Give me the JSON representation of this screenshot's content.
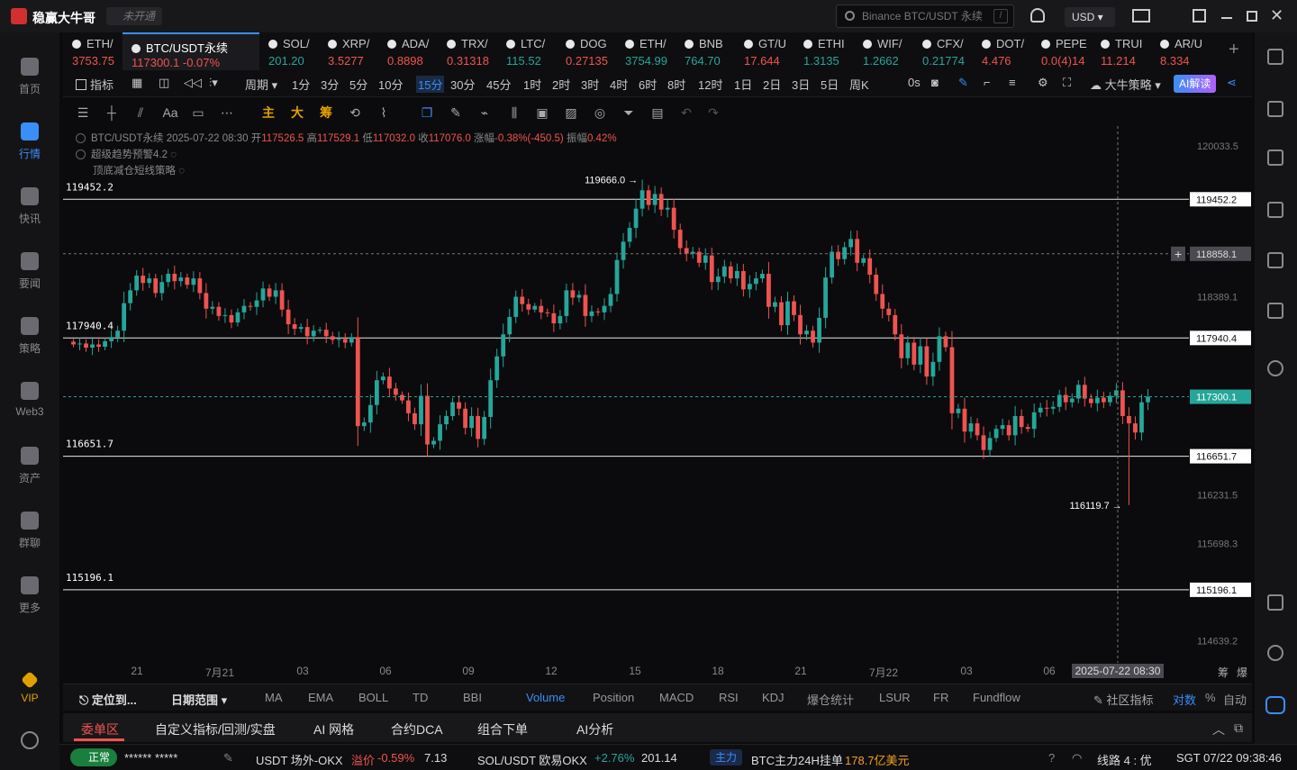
{
  "app": {
    "title": "稳赢大牛哥",
    "status_badge": "未开通"
  },
  "search": {
    "placeholder": "Binance BTC/USDT 永续",
    "shortcut": "/"
  },
  "currency": "USD",
  "sidebar": {
    "items": [
      {
        "label": "首页"
      },
      {
        "label": "行情"
      },
      {
        "label": "快讯"
      },
      {
        "label": "要闻"
      },
      {
        "label": "策略"
      },
      {
        "label": "Web3"
      },
      {
        "label": "资产"
      },
      {
        "label": "群聊"
      },
      {
        "label": "更多"
      },
      {
        "label": "VIP"
      }
    ],
    "active_index": 1
  },
  "tickers": [
    {
      "sym": "ETH/",
      "price": "3753.75",
      "dir": "down"
    },
    {
      "sym": "BTC/USDT永续",
      "price": "117300.1  -0.07%",
      "dir": "down"
    },
    {
      "sym": "SOL/",
      "price": "201.20",
      "dir": "up"
    },
    {
      "sym": "XRP/",
      "price": "3.5277",
      "dir": "down"
    },
    {
      "sym": "ADA/",
      "price": "0.8898",
      "dir": "down"
    },
    {
      "sym": "TRX/",
      "price": "0.31318",
      "dir": "down"
    },
    {
      "sym": "LTC/",
      "price": "115.52",
      "dir": "up"
    },
    {
      "sym": "DOG",
      "price": "0.27135",
      "dir": "down"
    },
    {
      "sym": "ETH/",
      "price": "3754.99",
      "dir": "up"
    },
    {
      "sym": "BNB",
      "price": "764.70",
      "dir": "up"
    },
    {
      "sym": "GT/U",
      "price": "17.644",
      "dir": "down"
    },
    {
      "sym": "ETHI",
      "price": "1.3135",
      "dir": "up"
    },
    {
      "sym": "WIF/",
      "price": "1.2662",
      "dir": "up"
    },
    {
      "sym": "CFX/",
      "price": "0.21774",
      "dir": "up"
    },
    {
      "sym": "DOT/",
      "price": "4.476",
      "dir": "down"
    },
    {
      "sym": "PEPE",
      "price": "0.0(4)14",
      "dir": "down"
    },
    {
      "sym": "TRUI",
      "price": "11.214",
      "dir": "down"
    },
    {
      "sym": "AR/U",
      "price": "8.334",
      "dir": "down"
    }
  ],
  "toolbar": {
    "indicator": "指标",
    "period": "周期",
    "periods": [
      "1分",
      "3分",
      "5分",
      "10分",
      "15分",
      "30分",
      "45分",
      "1时",
      "2时",
      "3时",
      "4时",
      "6时",
      "8时",
      "12时",
      "1日",
      "2日",
      "3日",
      "5日",
      "周K"
    ],
    "selected_period": "15分",
    "countdown": "0s",
    "strategy": "大牛策略",
    "ai_read": "AI解读"
  },
  "draw_tools": {
    "main": "主",
    "big": "大",
    "chip": "筹",
    "font": "Aa"
  },
  "legend": {
    "line1": {
      "pair": "BTC/USDT永续",
      "time": "2025-07-22 08:30",
      "open_label": "开",
      "open": "117526.5",
      "high_label": "高",
      "high": "117529.1",
      "low_label": "低",
      "low": "117032.0",
      "close_label": "收",
      "close": "117076.0",
      "change_label": "涨幅",
      "change": "-0.38%(-450.5)",
      "amp_label": "振幅",
      "amp": "0.42%"
    },
    "line2": "超级趋势预警4.2",
    "line3": "顶底减仓短线策略"
  },
  "price_axis": {
    "ticks": [
      "120033.5",
      "118389.1",
      "115698.3",
      "116231.5",
      "114639.2"
    ],
    "labels": {
      "h1": "119452.2",
      "crosshair": "118858.1",
      "h2": "117940.4",
      "last": "117300.1",
      "h3": "116651.7",
      "h4": "115196.1"
    },
    "hline_labels_left": [
      "119452.2",
      "117940.4",
      "116651.7",
      "115196.1"
    ],
    "high_marker": "119666.0",
    "low_marker": "116119.7"
  },
  "time_axis": {
    "labels": [
      "21",
      "7月21",
      "03",
      "06",
      "09",
      "12",
      "15",
      "18",
      "21",
      "7月22",
      "03",
      "06"
    ],
    "cursor": "2025-07-22 08:30",
    "right1": "筹",
    "right2": "爆"
  },
  "indicator_bar": {
    "locate": "定位到...",
    "range": "日期范围",
    "items": [
      "MA",
      "EMA",
      "BOLL",
      "TD",
      "BBI",
      "Volume",
      "Position",
      "MACD",
      "RSI",
      "KDJ",
      "爆仓统计",
      "LSUR",
      "FR",
      "Fundflow"
    ],
    "selected": "Volume",
    "community": "社区指标",
    "compare": "对数",
    "percent": "%",
    "auto": "自动"
  },
  "bottom_tabs": {
    "items": [
      "委单区",
      "自定义指标/回测/实盘",
      "AI 网格",
      "合约DCA",
      "组合下单",
      "AI分析"
    ],
    "selected": "委单区"
  },
  "status_bar": {
    "normal": "正常",
    "account": "******  *****",
    "usdt": "USDT 场外-OKX",
    "premium_label": "溢价",
    "premium": "-0.59%",
    "usdt_price": "7.13",
    "sol": "SOL/USDT 欧易OKX",
    "sol_change": "+2.76%",
    "sol_price": "201.14",
    "main_label": "主力",
    "btc_text": "BTC主力24H挂单",
    "btc_value": "178.7亿美元",
    "line": "线路 4 : 优",
    "time": "SGT 07/22 09:38:46"
  },
  "chart_data": {
    "type": "candlestick",
    "ylim": [
      114400,
      120250
    ],
    "colors": {
      "up": "#26a69a",
      "down": "#ef5350",
      "bg": "#0b0b0d",
      "accent": "#3a8ef6"
    },
    "hlines": [
      119452.2,
      117940.4,
      116651.7,
      115196.1
    ],
    "crosshair_price": 118858.1,
    "last_price": 117300.1,
    "high_point": 119666.0,
    "low_point": 116119.7,
    "closes": [
      117870,
      117880,
      117835,
      117870,
      117845,
      117905,
      117950,
      118020,
      118320,
      118460,
      118620,
      118540,
      118590,
      118430,
      118550,
      118640,
      118560,
      118600,
      118520,
      118590,
      118430,
      118260,
      118280,
      118180,
      118190,
      118110,
      118220,
      118290,
      118280,
      118350,
      118480,
      118390,
      118460,
      118250,
      118090,
      118040,
      118060,
      117960,
      118020,
      118030,
      117960,
      117920,
      117930,
      117890,
      117950,
      116980,
      117020,
      117210,
      117480,
      117520,
      117390,
      117320,
      117260,
      117120,
      117000,
      117310,
      116780,
      116820,
      117000,
      117090,
      117240,
      117170,
      116960,
      117090,
      116840,
      117080,
      117480,
      117740,
      117980,
      118170,
      118390,
      118310,
      118250,
      118290,
      118220,
      118210,
      118100,
      118180,
      118460,
      118380,
      118410,
      118180,
      118230,
      118220,
      118290,
      118420,
      118790,
      118990,
      119140,
      119350,
      119550,
      119390,
      119510,
      119340,
      119360,
      119120,
      118920,
      118860,
      118880,
      118760,
      118840,
      118550,
      118610,
      118720,
      118590,
      118670,
      118470,
      118530,
      118590,
      118640,
      118280,
      118330,
      118080,
      118340,
      118190,
      117980,
      118020,
      117890,
      118160,
      118600,
      118880,
      118800,
      118930,
      119020,
      118760,
      118810,
      118630,
      118420,
      118260,
      118190,
      117980,
      117720,
      117890,
      117650,
      117850,
      117520,
      117680,
      117960,
      117840,
      117120,
      117170,
      116920,
      117010,
      116880,
      116720,
      116850,
      116950,
      116990,
      116880,
      117090,
      116970,
      116950,
      117130,
      117180,
      117170,
      117190,
      117320,
      117240,
      117280,
      117430,
      117280,
      117230,
      117290,
      117240,
      117310,
      117370,
      117090,
      117010,
      116910,
      117240,
      117300
    ]
  }
}
